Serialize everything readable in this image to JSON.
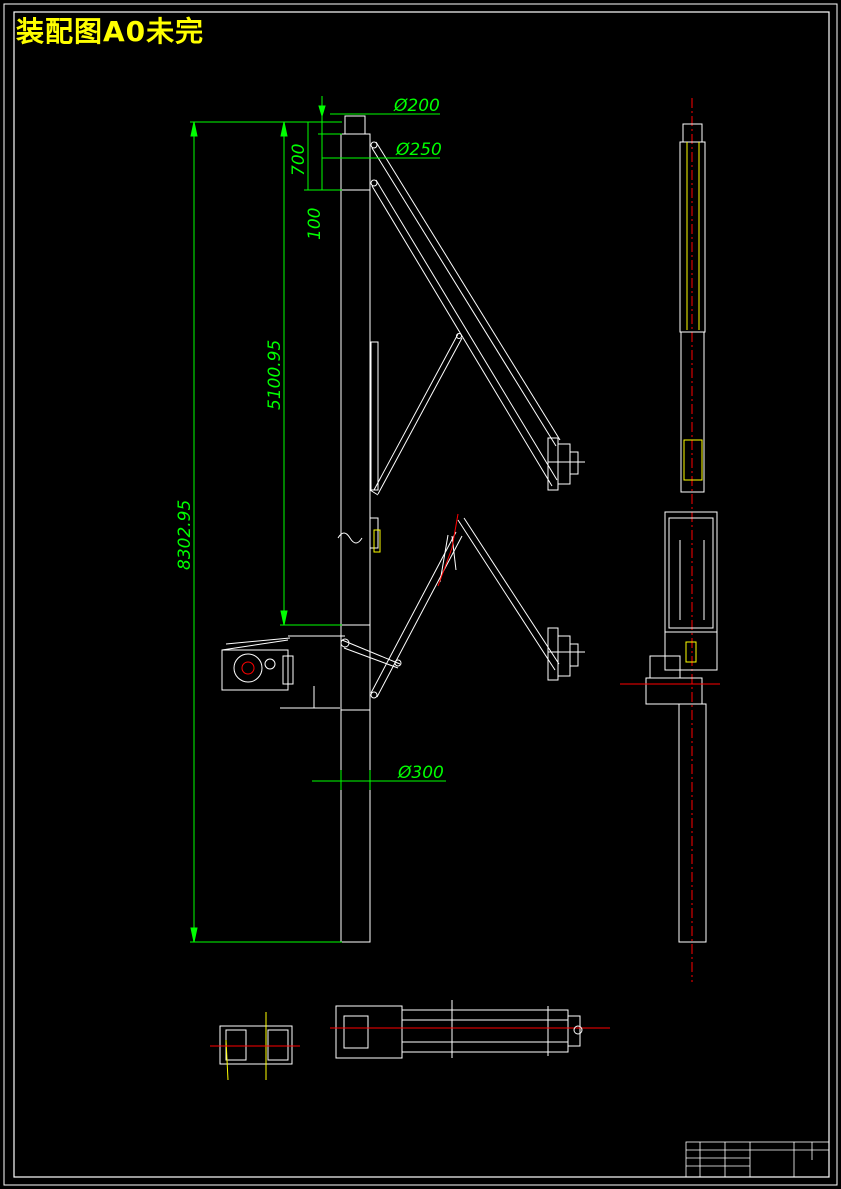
{
  "title": "装配图A0未完",
  "dimensions": {
    "d_top": "Ø200",
    "d_upper": "Ø250",
    "d_lower": "Ø300",
    "len_700": "700",
    "len_100": "100",
    "len_5100": "5100.95",
    "len_total": "8302.95"
  },
  "colors": {
    "background": "#000000",
    "frame": "#ffffff",
    "dimension": "#00ff00",
    "centerline": "#ff0000",
    "title": "#ffff00",
    "detail": "#ffff00"
  }
}
